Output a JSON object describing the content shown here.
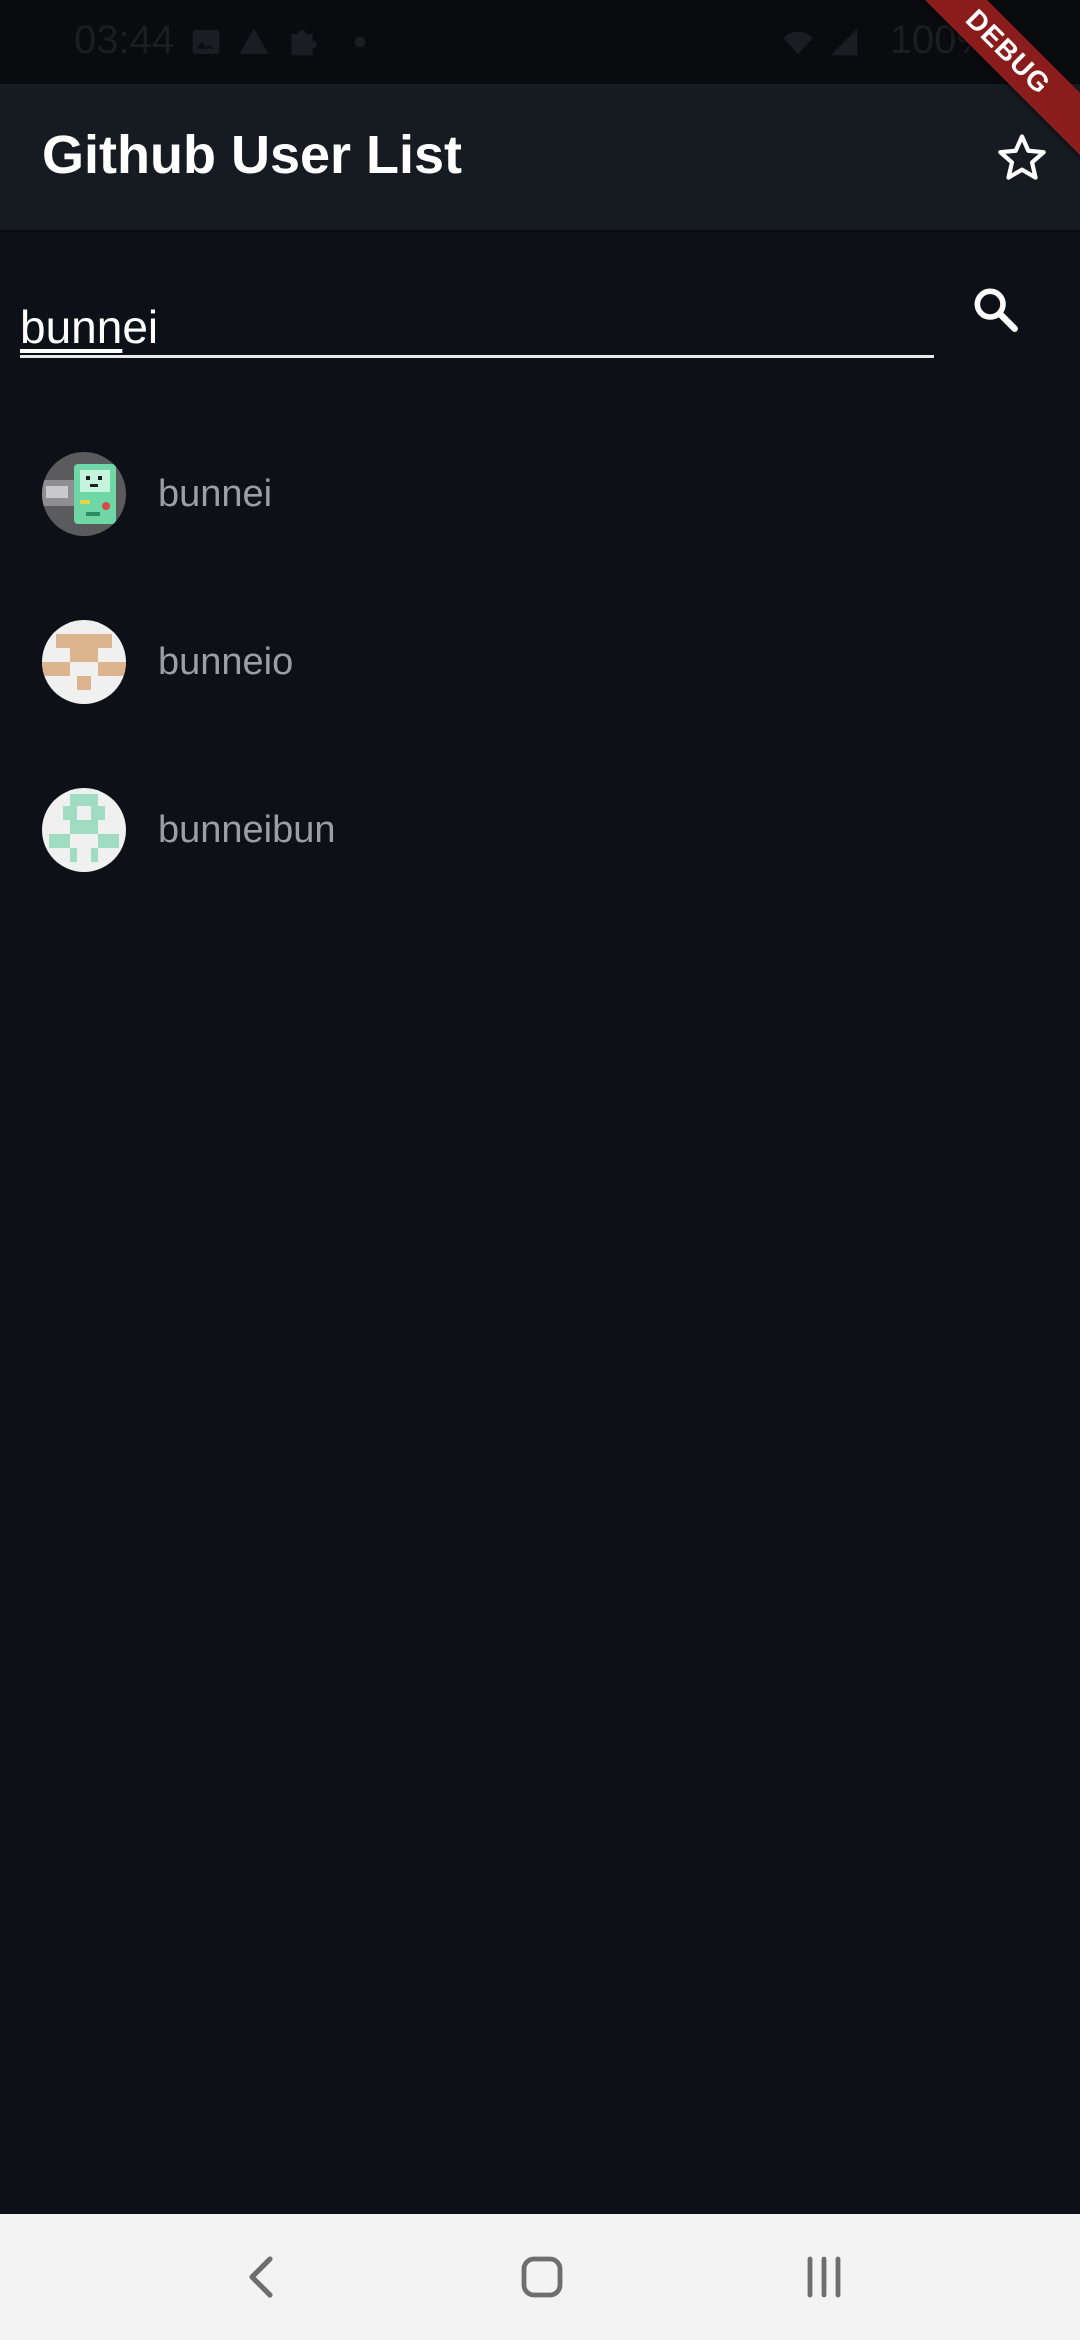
{
  "status_bar": {
    "time": "03:44",
    "battery": "100%",
    "icons": [
      "image-icon",
      "warning-icon",
      "puzzle-icon",
      "dot-icon",
      "wifi-icon",
      "signal-icon"
    ]
  },
  "app_bar": {
    "title": "Github User List",
    "favorite_icon": "star-outline-icon"
  },
  "debug_banner": "DEBUG",
  "search": {
    "value_underlined": "bunn",
    "value_rest": "ei",
    "search_icon": "search-icon"
  },
  "users": [
    {
      "name": "bunnei",
      "avatar": "pixel-robot-avatar"
    },
    {
      "name": "bunneio",
      "avatar": "identicon-tan"
    },
    {
      "name": "bunneibun",
      "avatar": "identicon-mint"
    }
  ],
  "colors": {
    "background": "#0d1017",
    "app_bar": "#161b22",
    "text_primary": "#ffffff",
    "text_secondary": "#9b9ea4",
    "debug_banner": "#8a1c1c",
    "identicon_tan": "#dcb58f",
    "identicon_mint": "#9fdcc1"
  },
  "nav_bar": {
    "buttons": [
      "back-icon",
      "home-icon",
      "recents-icon"
    ]
  }
}
